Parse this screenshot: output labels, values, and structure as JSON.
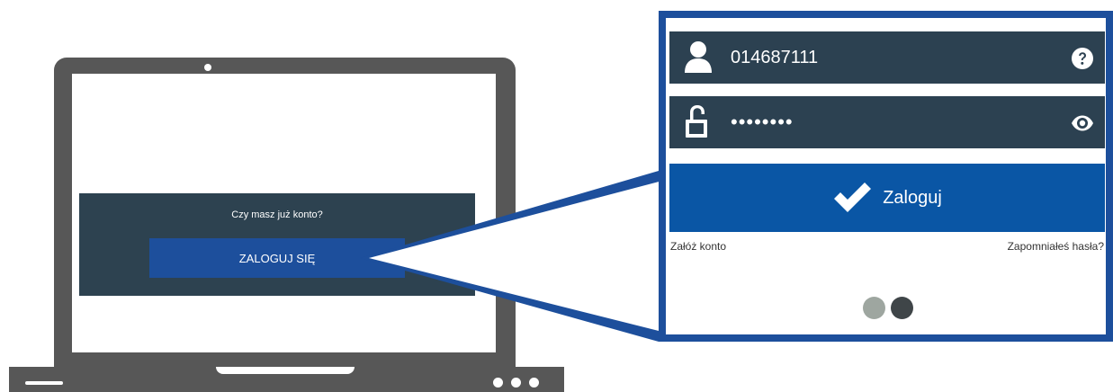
{
  "laptop": {
    "question": "Czy masz już konto?",
    "login_cta_label": "ZALOGUJ SIĘ"
  },
  "zoom": {
    "username": {
      "value": "014687111",
      "icon": "user-icon",
      "help_icon": "help-icon"
    },
    "password": {
      "value": "••••••••",
      "icon": "unlock-icon",
      "toggle_icon": "eye-icon"
    },
    "submit_label": "Zaloguj",
    "register_link": "Załóż konto",
    "forgot_link": "Zapomniałeś hasła?",
    "carousel": {
      "count": 2,
      "active_index": 1
    }
  },
  "colors": {
    "laptop_body": "#575757",
    "panel_bg": "#2d4250",
    "cta_blue": "#1d4f9c",
    "zoom_border": "#1d4f9c",
    "field_bg": "#2c4151",
    "submit_blue": "#0a56a5",
    "dot_inactive": "#9ea6a0",
    "dot_active": "#3f4548"
  }
}
